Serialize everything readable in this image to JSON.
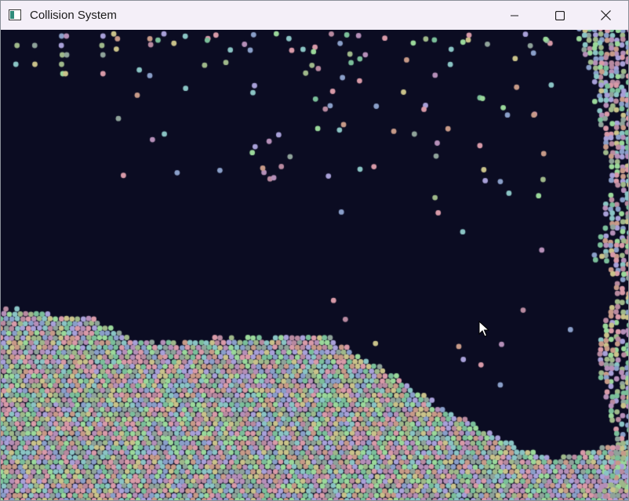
{
  "window": {
    "title": "Collision System",
    "controls": {
      "minimize": "minimize-icon",
      "maximize": "maximize-icon",
      "close": "close-icon"
    }
  },
  "scene": {
    "background": "#0b0c22",
    "particle_palette": [
      "#8fa39a",
      "#b58fb8",
      "#9fb88a",
      "#c79a88",
      "#8a9fc9",
      "#7bbf9a",
      "#c9c28a",
      "#b88aa0",
      "#8ac4c4",
      "#a8a0d8",
      "#d89aa8",
      "#9ad89a"
    ]
  }
}
